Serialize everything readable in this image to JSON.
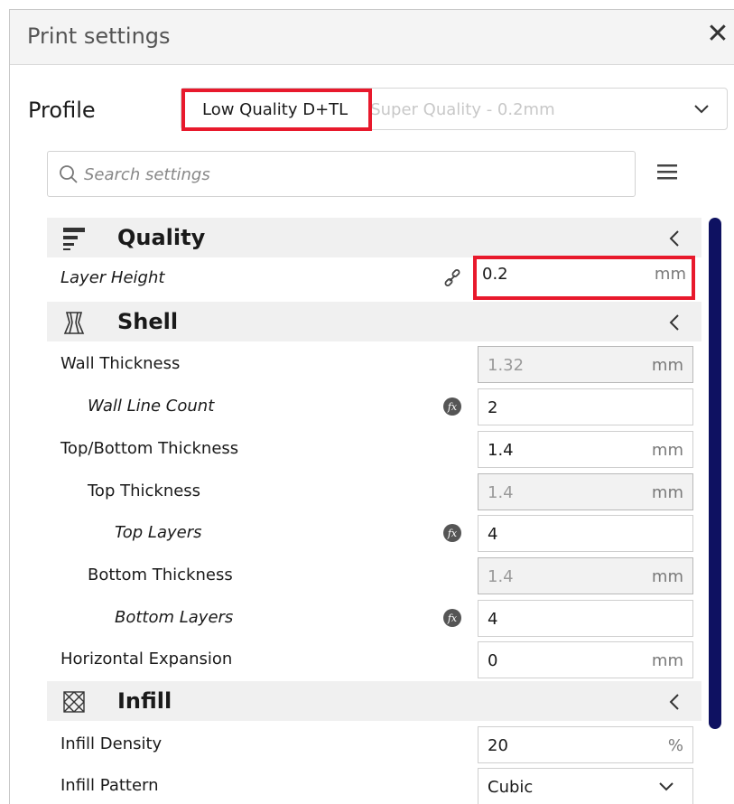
{
  "window": {
    "title": "Print settings",
    "close_label": "✕"
  },
  "profile": {
    "label": "Profile",
    "selected": "Low Quality D+TL",
    "underlying": "- Super Quality - 0.2mm"
  },
  "search": {
    "placeholder": "Search settings"
  },
  "categories": [
    {
      "label": "Quality",
      "icon": "quality-icon",
      "settings": [
        {
          "label": "Layer Height",
          "value": "0.2",
          "unit": "mm",
          "italic": true,
          "icon": "link-icon"
        }
      ]
    },
    {
      "label": "Shell",
      "icon": "shell-icon",
      "settings": [
        {
          "label": "Wall Thickness",
          "value": "1.32",
          "unit": "mm"
        },
        {
          "label": "Wall Line Count",
          "value": "2",
          "unit": "",
          "italic": true,
          "icon": "function-icon"
        },
        {
          "label": "Top/Bottom Thickness",
          "value": "1.4",
          "unit": "mm"
        },
        {
          "label": "Top Thickness",
          "value": "1.4",
          "unit": "mm"
        },
        {
          "label": "Top Layers",
          "value": "4",
          "unit": "",
          "italic": true,
          "icon": "function-icon"
        },
        {
          "label": "Bottom Thickness",
          "value": "1.4",
          "unit": "mm"
        },
        {
          "label": "Bottom Layers",
          "value": "4",
          "unit": "",
          "italic": true,
          "icon": "function-icon"
        },
        {
          "label": "Horizontal Expansion",
          "value": "0",
          "unit": "mm"
        }
      ]
    },
    {
      "label": "Infill",
      "icon": "infill-icon",
      "settings": [
        {
          "label": "Infill Density",
          "value": "20",
          "unit": "%"
        },
        {
          "label": "Infill Pattern",
          "value": "Cubic",
          "unit": ""
        }
      ]
    }
  ],
  "colors": {
    "highlight": "#e8192c",
    "scrollbar": "#0e1161"
  }
}
